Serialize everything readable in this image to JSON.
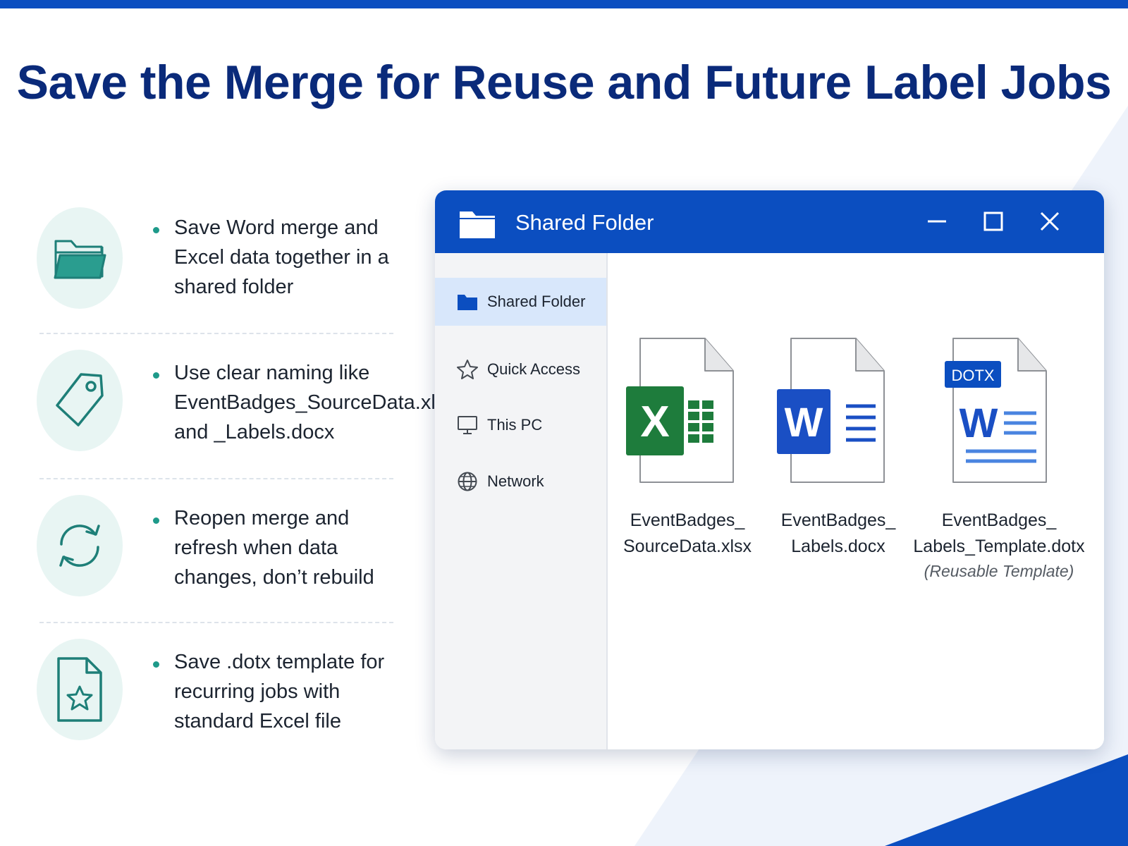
{
  "page": {
    "title": "Save the Merge for Reuse and Future Label Jobs"
  },
  "tips": [
    {
      "icon": "folder-icon",
      "text": "Save Word merge and Excel data together in a shared folder"
    },
    {
      "icon": "tag-icon",
      "text": "Use clear naming like EventBadges_SourceData.xlsx and _Labels.docx"
    },
    {
      "icon": "refresh-icon",
      "text": "Reopen merge and refresh when data changes, don’t rebuild"
    },
    {
      "icon": "star-document-icon",
      "text": "Save .dotx template for recurring jobs with standard Excel file"
    }
  ],
  "window": {
    "title": "Shared Folder",
    "controls": [
      "minimize",
      "maximize",
      "close"
    ]
  },
  "sidebar": {
    "items": [
      {
        "label": "Shared Folder",
        "icon": "folder-icon",
        "active": true
      },
      {
        "label": "Quick Access",
        "icon": "star-icon",
        "active": false
      },
      {
        "label": "This PC",
        "icon": "monitor-icon",
        "active": false
      },
      {
        "label": "Network",
        "icon": "globe-icon",
        "active": false
      }
    ]
  },
  "files": [
    {
      "name_line1": "EventBadges_",
      "name_line2": "SourceData.xlsx",
      "subtitle": "",
      "icon": "excel-icon"
    },
    {
      "name_line1": "EventBadges_",
      "name_line2": "Labels.docx",
      "subtitle": "",
      "icon": "word-icon"
    },
    {
      "name_line1": "EventBadges_",
      "name_line2": "Labels_Template.dotx",
      "subtitle": "(Reusable Template)",
      "icon": "word-template-icon",
      "badge": "DOTX"
    }
  ],
  "colors": {
    "accent": "#0b4ec0",
    "title": "#0a2a7a",
    "teal": "#1e9a8a",
    "excel_green": "#1e7c3c",
    "word_blue": "#1a4fc4"
  }
}
